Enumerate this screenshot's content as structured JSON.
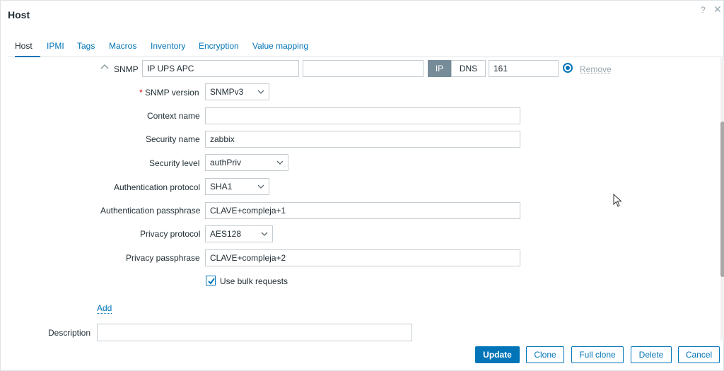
{
  "dialog": {
    "title": "Host",
    "help": "?",
    "close": "✕"
  },
  "tabs": [
    {
      "label": "Host",
      "active": true
    },
    {
      "label": "IPMI"
    },
    {
      "label": "Tags"
    },
    {
      "label": "Macros"
    },
    {
      "label": "Inventory"
    },
    {
      "label": "Encryption"
    },
    {
      "label": "Value mapping"
    }
  ],
  "interface": {
    "type_label": "SNMP",
    "ip_value": "IP UPS APC",
    "dns_value": "",
    "connect_ip": "IP",
    "connect_dns": "DNS",
    "port": "161",
    "remove": "Remove"
  },
  "fields": {
    "snmp_version_required": "*",
    "snmp_version_label": "SNMP version",
    "snmp_version": "SNMPv3",
    "context_name_label": "Context name",
    "context_name": "",
    "security_name_label": "Security name",
    "security_name": "zabbix",
    "security_level_label": "Security level",
    "security_level": "authPriv",
    "auth_protocol_label": "Authentication protocol",
    "auth_protocol": "SHA1",
    "auth_pass_label": "Authentication passphrase",
    "auth_pass": "CLAVE+compleja+1",
    "priv_protocol_label": "Privacy protocol",
    "priv_protocol": "AES128",
    "priv_pass_label": "Privacy passphrase",
    "priv_pass": "CLAVE+compleja+2",
    "bulk_label": "Use bulk requests",
    "bulk_checked": true
  },
  "add_label": "Add",
  "description_label": "Description",
  "buttons": {
    "update": "Update",
    "clone": "Clone",
    "full_clone": "Full clone",
    "delete": "Delete",
    "cancel": "Cancel"
  },
  "colors": {
    "accent": "#0275b8",
    "segment_active": "#768d99",
    "required": "#d40000"
  }
}
